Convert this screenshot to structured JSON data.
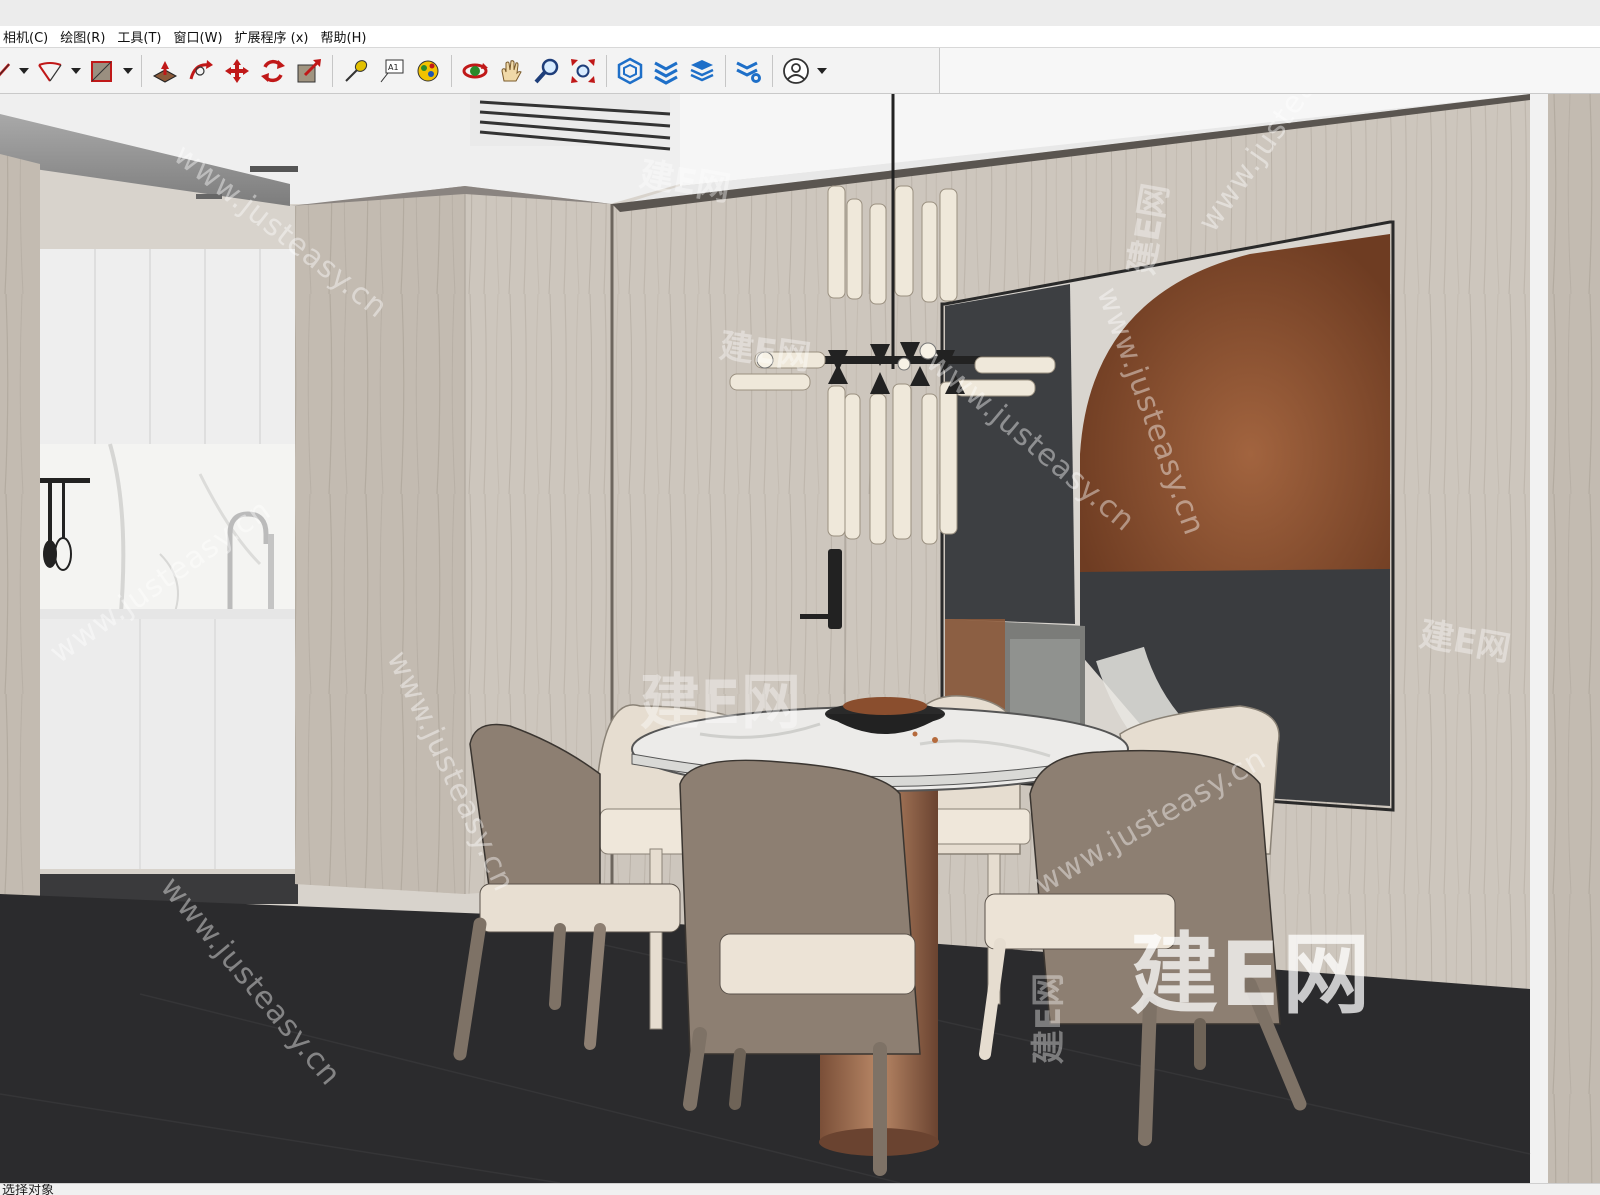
{
  "menu": {
    "items": [
      {
        "label": "相机(C)"
      },
      {
        "label": "绘图(R)"
      },
      {
        "label": "工具(T)"
      },
      {
        "label": "窗口(W)"
      },
      {
        "label": "扩展程序 (x)"
      },
      {
        "label": "帮助(H)"
      }
    ]
  },
  "toolbar": {
    "tools": [
      "line-tool-icon",
      "arc-tool-icon",
      "shape-tool-icon",
      "push-pull-icon",
      "follow-me-icon",
      "move-icon",
      "rotate-icon",
      "scale-icon",
      "tape-measure-icon",
      "text-icon",
      "paint-bucket-icon",
      "orbit-icon",
      "pan-icon",
      "zoom-icon",
      "zoom-extents-icon",
      "extension-warehouse-icon",
      "layers-icon",
      "stack-icon",
      "settings-stack-icon",
      "user-account-icon"
    ]
  },
  "watermarks": {
    "url": "www.justeasy.cn",
    "cn": "建E网",
    "big": "建E网"
  },
  "status": {
    "text": "选择对象"
  },
  "colors": {
    "wall_wood": "#cfc8bf",
    "floor": "#2b2b2d",
    "chair_taupe": "#8d7f72",
    "chair_cream": "#e8dfd2",
    "art_rust": "#8a4e2e",
    "art_dark": "#3a3c3f",
    "toolbar_bg": "#f3f3f3"
  }
}
